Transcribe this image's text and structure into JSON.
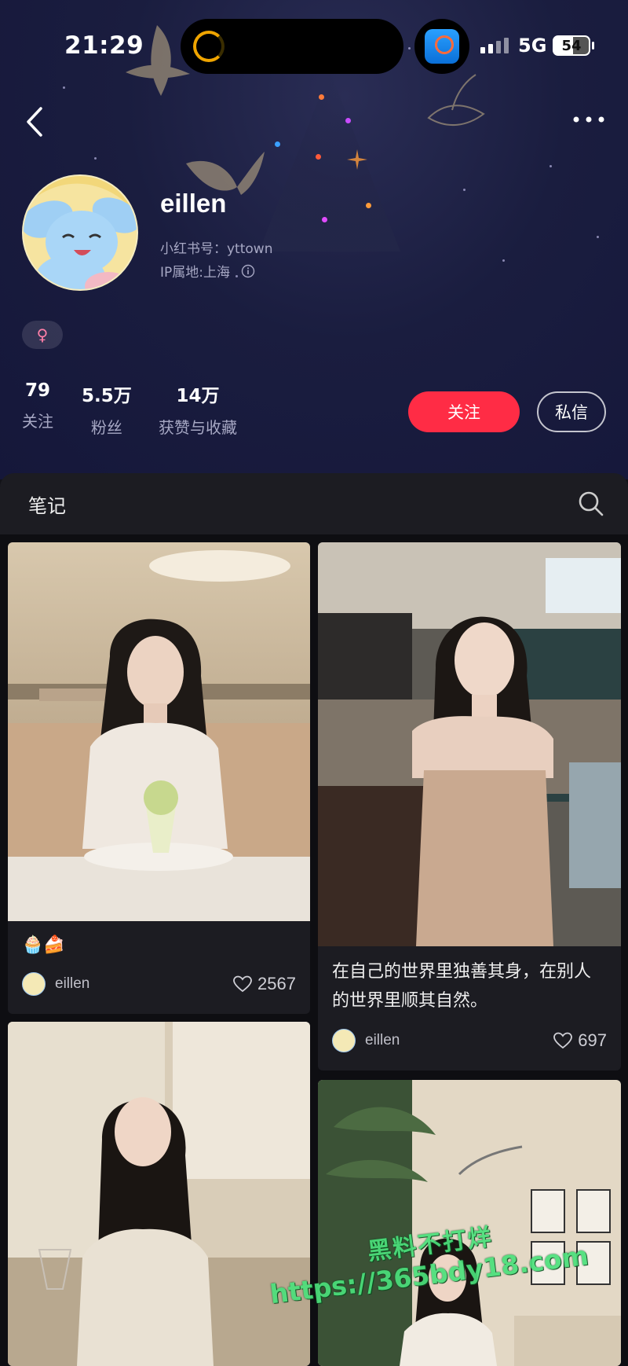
{
  "status_bar": {
    "time": "21:29",
    "network": "5G",
    "battery": "54"
  },
  "profile": {
    "username": "eillen",
    "red_id_label": "小红书号：",
    "red_id": "yttown",
    "ip_label": "IP属地: ",
    "ip_location": "上海",
    "gender_icon": "♀",
    "stats": [
      {
        "value": "79",
        "label": "关注"
      },
      {
        "value": "5.5万",
        "label": "粉丝"
      },
      {
        "value": "14万",
        "label": "获赞与收藏"
      }
    ],
    "follow_label": "关注",
    "message_label": "私信"
  },
  "tabs": {
    "notes": "笔记"
  },
  "notes": [
    {
      "title": "🧁🍰",
      "author": "eillen",
      "likes": "2567"
    },
    {
      "title": "在自己的世界里独善其身，在别人的世界里顺其自然。",
      "author": "eillen",
      "likes": "697"
    },
    {
      "title": "",
      "author": "",
      "likes": ""
    },
    {
      "title": "",
      "author": "",
      "likes": ""
    }
  ],
  "watermark": {
    "line1": "黑料不打烊",
    "line2": "https://365bdy18.com"
  },
  "colors": {
    "accent": "#ff2c45",
    "header_bg": "#1a1d3f",
    "feed_bg": "#0e0e12",
    "card_bg": "#1c1c22"
  }
}
